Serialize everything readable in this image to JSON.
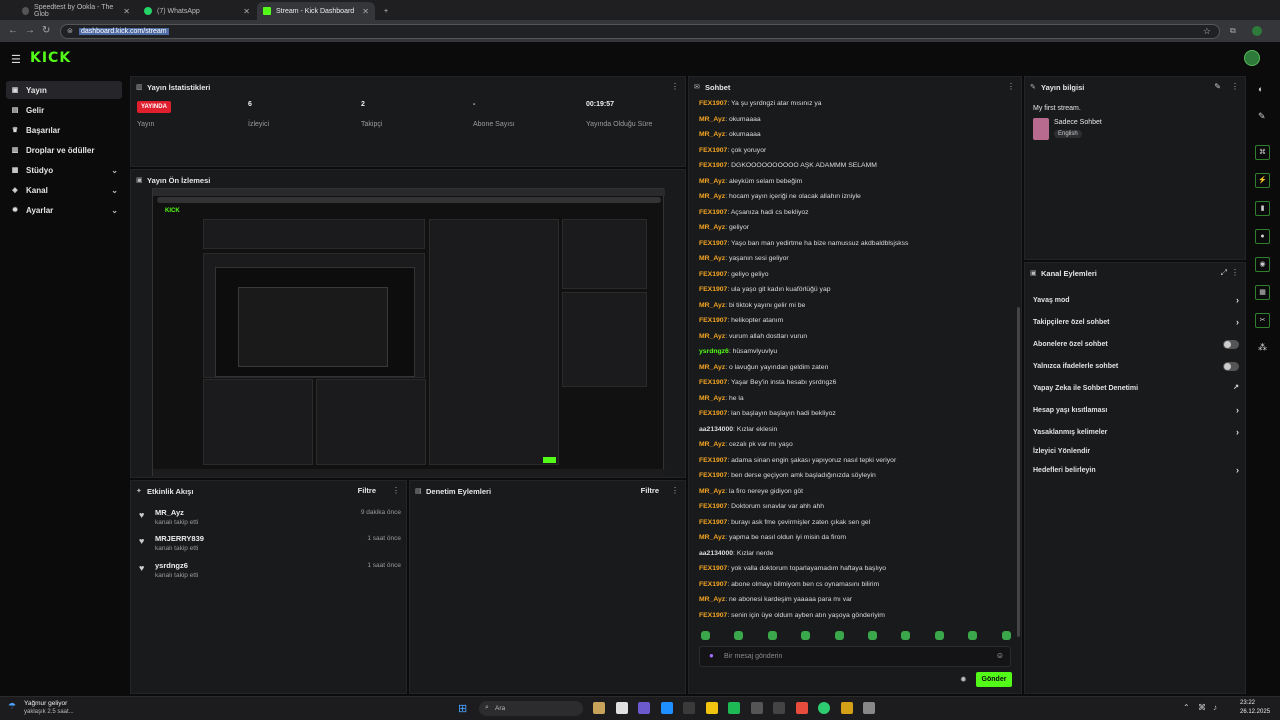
{
  "browser": {
    "tabs": [
      {
        "title": "Speedtest by Ookla - The Glob",
        "color": "#2c2c2c"
      },
      {
        "title": "(7) WhatsApp",
        "color": "#25d366"
      },
      {
        "title": "Stream - Kick Dashboard",
        "color": "#53fc18"
      }
    ],
    "url": "dashboard.kick.com/stream"
  },
  "header": {
    "logo": "KICK"
  },
  "sidebar": {
    "items": [
      {
        "label": "Yayın",
        "icon": "broadcast-icon",
        "glyph": "▣"
      },
      {
        "label": "Gelir",
        "icon": "revenue-icon",
        "glyph": "▤"
      },
      {
        "label": "Başarılar",
        "icon": "trophy-icon",
        "glyph": "♛"
      },
      {
        "label": "Droplar ve ödüller",
        "icon": "gift-icon",
        "glyph": "▥"
      },
      {
        "label": "Stüdyo",
        "icon": "studio-icon",
        "glyph": "▦"
      },
      {
        "label": "Kanal",
        "icon": "channel-icon",
        "glyph": "◈"
      },
      {
        "label": "Ayarlar",
        "icon": "gear-icon",
        "glyph": "✹"
      }
    ]
  },
  "stats": {
    "title": "Yayın İstatistikleri",
    "live_badge": "YAYINDA",
    "items": [
      {
        "value": "",
        "label": "Yayın"
      },
      {
        "value": "6",
        "label": "İzleyici"
      },
      {
        "value": "2",
        "label": "Takipçi"
      },
      {
        "value": "-",
        "label": "Abone Sayısı"
      },
      {
        "value": "00:19:57",
        "label": "Yayında Olduğu Süre"
      }
    ]
  },
  "preview": {
    "title": "Yayın Ön İzlemesi"
  },
  "activity": {
    "title": "Etkinlik Akışı",
    "filter": "Filtre",
    "items": [
      {
        "name": "MR_Ayz",
        "action": "kanalı takip etti",
        "time": "9 dakika önce"
      },
      {
        "name": "MRJERRY839",
        "action": "kanalı takip etti",
        "time": "1 saat önce"
      },
      {
        "name": "ysrdngz6",
        "action": "kanalı takip etti",
        "time": "1 saat önce"
      }
    ]
  },
  "moderation": {
    "title": "Denetim Eylemleri",
    "filter": "Filtre"
  },
  "chat": {
    "title": "Sohbet",
    "messages": [
      {
        "user": "FEX1907",
        "color": "#f5a623",
        "text": "Ya şu ysrdngzi atar mısınız ya"
      },
      {
        "user": "MR_Ayz",
        "color": "#f5a623",
        "text": "okumaaaa"
      },
      {
        "user": "MR_Ayz",
        "color": "#f5a623",
        "text": "okumaaaa"
      },
      {
        "user": "FEX1907",
        "color": "#f5a623",
        "text": "çok yoruyor"
      },
      {
        "user": "FEX1907",
        "color": "#f5a623",
        "text": "DGKOOOOOOOOOO AŞK ADAMMM SELAMM"
      },
      {
        "user": "MR_Ayz",
        "color": "#f5a623",
        "text": "aleyküm selam bebeğim"
      },
      {
        "user": "MR_Ayz",
        "color": "#f5a623",
        "text": "hocam yayın içeriği ne olacak allahın izniyle"
      },
      {
        "user": "FEX1907",
        "color": "#f5a623",
        "text": "Açsanıza hadi cs bekliyoz"
      },
      {
        "user": "MR_Ayz",
        "color": "#f5a623",
        "text": "geliyor"
      },
      {
        "user": "FEX1907",
        "color": "#f5a623",
        "text": "Yaşo ban man yedirtme ha bize namussuz akdbaldblsjskss"
      },
      {
        "user": "MR_Ayz",
        "color": "#f5a623",
        "text": "yaşanın sesi geliyor"
      },
      {
        "user": "FEX1907",
        "color": "#f5a623",
        "text": "geliyo geliyo"
      },
      {
        "user": "FEX1907",
        "color": "#f5a623",
        "text": "ula yaşo git kadın kuaförlüğü yap"
      },
      {
        "user": "MR_Ayz",
        "color": "#f5a623",
        "text": "bi tiktok yayını gelir mi be"
      },
      {
        "user": "FEX1907",
        "color": "#f5a623",
        "text": "helikopter atanım"
      },
      {
        "user": "MR_Ayz",
        "color": "#f5a623",
        "text": "vurum allah dostları vurun"
      },
      {
        "user": "ysrdngz6",
        "color": "#53fc18",
        "text": "hüsamvlyuvlyu"
      },
      {
        "user": "MR_Ayz",
        "color": "#f5a623",
        "text": "o lavuğun yayından geldim zaten"
      },
      {
        "user": "FEX1907",
        "color": "#f5a623",
        "text": "Yaşar Bey'in insta hesabı ysrdngz6"
      },
      {
        "user": "MR_Ayz",
        "color": "#f5a623",
        "text": "he la"
      },
      {
        "user": "FEX1907",
        "color": "#f5a623",
        "text": "lan başlayın başlayın hadi bekliyoz"
      },
      {
        "user": "aa2134000",
        "color": "#dcdcdc",
        "text": "Kızlar eklesin"
      },
      {
        "user": "MR_Ayz",
        "color": "#f5a623",
        "text": "cezalı pk var mı yaşo"
      },
      {
        "user": "FEX1907",
        "color": "#f5a623",
        "text": "adama sinan engin şakası yapıyoruz nasıl tepki veriyor"
      },
      {
        "user": "FEX1907",
        "color": "#f5a623",
        "text": "ben derse geçiyom amk başladığınızda söyleyin"
      },
      {
        "user": "MR_Ayz",
        "color": "#f5a623",
        "text": "la firo nereye gidiyon göt"
      },
      {
        "user": "FEX1907",
        "color": "#f5a623",
        "text": "Doktorum sınavlar var ahh ahh"
      },
      {
        "user": "FEX1907",
        "color": "#f5a623",
        "text": "burayı ask fme çevirmişler zaten çıkak sen gel"
      },
      {
        "user": "MR_Ayz",
        "color": "#f5a623",
        "text": "yapma be nasıl oldun iyi misin da firom"
      },
      {
        "user": "aa2134000",
        "color": "#dcdcdc",
        "text": "Kızlar nerde"
      },
      {
        "user": "FEX1907",
        "color": "#f5a623",
        "text": "yok valla doktorum toparlayamadım haftaya başlıyo"
      },
      {
        "user": "FEX1907",
        "color": "#f5a623",
        "text": "abone olmayı bilmiyom ben cs oynamasını bilirim"
      },
      {
        "user": "MR_Ayz",
        "color": "#f5a623",
        "text": "ne abonesi kardeşim yaaaaa para mı var"
      },
      {
        "user": "FEX1907",
        "color": "#f5a623",
        "text": "senin için üye oldum ayben atın yaşoya gönderiyim"
      }
    ],
    "input_placeholder": "Bir mesaj gönderin",
    "send_label": "Gönder"
  },
  "stream_info": {
    "title": "Yayın bilgisi",
    "stream_title": "My first stream.",
    "category": "Sadece Sohbet",
    "language": "English"
  },
  "channel_actions": {
    "title": "Kanal Eylemleri",
    "items": [
      {
        "label": "Yavaş mod",
        "type": "arrow"
      },
      {
        "label": "Takipçilere özel sohbet",
        "type": "arrow"
      },
      {
        "label": "Abonelere özel sohbet",
        "type": "toggle"
      },
      {
        "label": "Yalnızca ifadelerle sohbet",
        "type": "toggle"
      },
      {
        "label": "Yapay Zeka ile Sohbet Denetimi",
        "type": "external"
      },
      {
        "label": "Hesap yaşı kısıtlaması",
        "type": "arrow"
      },
      {
        "label": "Yasaklanmış kelimeler",
        "type": "arrow"
      },
      {
        "label": "İzleyici Yönlendir",
        "type": "none"
      },
      {
        "label": "Hedefleri belirleyin",
        "type": "arrow"
      }
    ]
  },
  "taskbar": {
    "weather_title": "Yağmur geliyor",
    "weather_sub": "yaklaşık 2.5 saat...",
    "search_placeholder": "Ara",
    "time": "23:22",
    "date": "26.12.2025"
  }
}
